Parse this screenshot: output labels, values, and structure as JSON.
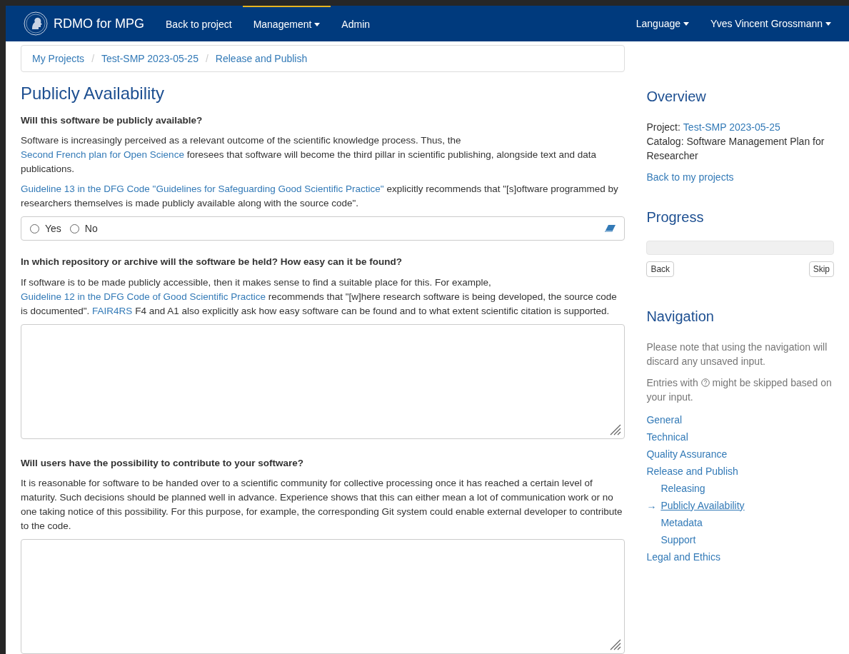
{
  "navbar": {
    "brand": "RDMO for MPG",
    "items": [
      {
        "label": "Back to project",
        "dropdown": false,
        "selected": false
      },
      {
        "label": "Management",
        "dropdown": true,
        "selected": true
      },
      {
        "label": "Admin",
        "dropdown": false,
        "selected": false
      }
    ],
    "right_items": [
      {
        "label": "Language",
        "dropdown": true
      },
      {
        "label": "Yves Vincent Grossmann",
        "dropdown": true
      }
    ]
  },
  "breadcrumb": {
    "separator": "/",
    "items": [
      "My Projects",
      "Test-SMP 2023-05-25",
      "Release and Publish"
    ]
  },
  "page_title": "Publicly Availability",
  "questions": [
    {
      "kind": "radio",
      "label": "Will this software be publicly available?",
      "paragraphs": [
        [
          {
            "text": "Software is increasingly perceived as a relevant outcome of the scientific knowledge process. Thus, the ",
            "link": false
          },
          {
            "text": "Second French plan for Open Science",
            "link": true
          },
          {
            "text": " foresees that software will become the third pillar in scientific publishing, alongside text and data publications.",
            "link": false
          }
        ],
        [
          {
            "text": "Guideline 13 in the DFG Code \"Guidelines for Safeguarding Good Scientific Practice\"",
            "link": true
          },
          {
            "text": " explicitly recommends that \"[s]oftware programmed by researchers themselves is made publicly available along with the source code\".",
            "link": false
          }
        ]
      ],
      "options": [
        {
          "label": "Yes",
          "selected": false
        },
        {
          "label": "No",
          "selected": false
        }
      ]
    },
    {
      "kind": "textarea",
      "label": "In which repository or archive will the software be held? How easy can it be found?",
      "paragraphs": [
        [
          {
            "text": "If software is to be made publicly accessible, then it makes sense to find a suitable place for this. For example, ",
            "link": false
          },
          {
            "text": "Guideline 12 in the DFG Code of Good Scientific Practice",
            "link": true
          },
          {
            "text": " recommends that \"[w]here research software is being developed, the source code is documented\". ",
            "link": false
          },
          {
            "text": "FAIR4RS",
            "link": true
          },
          {
            "text": " F4 and A1 also explicitly ask how easy software can be found and to what extent scientific citation is supported.",
            "link": false
          }
        ]
      ]
    },
    {
      "kind": "textarea",
      "label": "Will users have the possibility to contribute to your software?",
      "paragraphs": [
        [
          {
            "text": "It is reasonable for software to be handed over to a scientific community for collective processing once it has reached a certain level of maturity. Such decisions should be planned well in advance. Experience shows that this can either mean a lot of communication work or no one taking notice of this possibility. For this purpose, for example, the corresponding Git system could enable external developer to contribute to the code.",
            "link": false
          }
        ]
      ]
    }
  ],
  "sidebar": {
    "overview": {
      "title": "Overview",
      "project_label": "Project:",
      "project": "Test-SMP 2023-05-25",
      "catalog": "Catalog: Software Management Plan for Researcher",
      "back_link": "Back to my projects"
    },
    "progress": {
      "title": "Progress",
      "level": 0,
      "back": "Back",
      "skip": "Skip"
    },
    "navigation": {
      "title": "Navigation",
      "note": "Please note that using the navigation will discard any unsaved input.",
      "skip_note_before": "Entries with",
      "skip_note_after": "might be skipped based on your input.",
      "marker": "→",
      "items": [
        {
          "label": "General",
          "selected": false
        },
        {
          "label": "Technical",
          "selected": false
        },
        {
          "label": "Quality Assurance",
          "selected": false
        },
        {
          "label": "Release and Publish",
          "selected": false,
          "children": [
            {
              "label": "Releasing",
              "selected": false
            },
            {
              "label": "Publicly Availability",
              "selected": true
            },
            {
              "label": "Metadata",
              "selected": false
            },
            {
              "label": "Support",
              "selected": false
            }
          ]
        },
        {
          "label": "Legal and Ethics",
          "selected": false
        }
      ]
    }
  }
}
